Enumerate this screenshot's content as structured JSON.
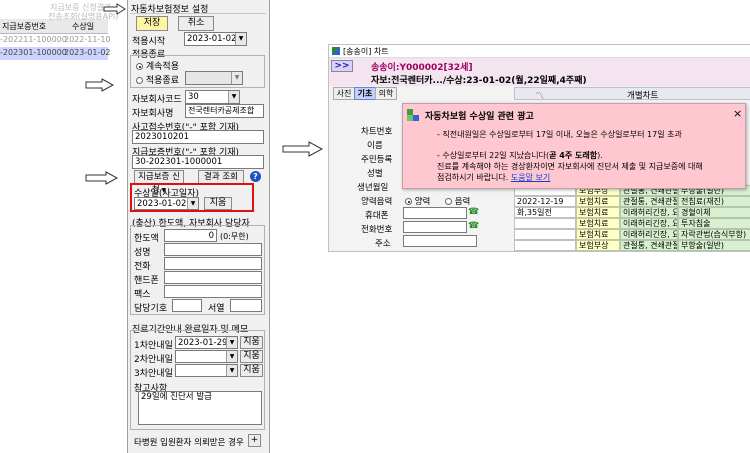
{
  "left_strip": {
    "overlay_text_1": "지급보증 신청결과",
    "overlay_text_2": "전송조회(실명용API)",
    "col_1": "지급보증번호",
    "col_2": "수상일",
    "rows": [
      {
        "no": "-202211-100000",
        "date": "2022-11-10"
      },
      {
        "no": "-202301-100000",
        "date": "2023-01-02"
      }
    ]
  },
  "panel": {
    "title": "자동차보험정보 설정",
    "save_label": "저장",
    "cancel_label": "취소",
    "apply_start_label": "적용시작",
    "apply_start_value": "2023-01-02",
    "apply_end_label": "적용종료",
    "continue_label": "계속적용",
    "end_label": "적용종료",
    "insurer_code_label": "자보회사코드",
    "insurer_code_value": "30",
    "insurer_name_label": "자보회사명",
    "insurer_name_value": "전국렌터카공제조합",
    "accident_no_label": "사고접수번호(\"-\" 포함 기재)",
    "accident_no_value": "2023010201",
    "guarantee_no_label": "지급보증번호(\"-\" 포함 기재)",
    "guarantee_no_value": "30-202301-1000001",
    "guarantee_request_label": "지급보증 신청",
    "result_query_label": "결과 조회",
    "help_icon_text": "?",
    "injury_date_label": "수상일(사고일자)",
    "injury_date_value": "2023-01-02",
    "injury_date_button": "지움",
    "limit_section_label": "(충산) 한도액, 자보회사 담당자",
    "limit_label": "한도액",
    "limit_value": "0",
    "limit_hint": "(0:무한)",
    "name_label": "성명",
    "phone_label": "전화",
    "mobile_label": "핸드폰",
    "fax_label": "팩스",
    "manager_code_label": "담당기호",
    "seoul_label": "서열",
    "memo_section_label": "진료기간안내 완료일자 및 메모",
    "notice1_label": "1차안내일",
    "notice1_value": "2023-01-29",
    "notice2_label": "2차안내일",
    "notice3_label": "3차안내일",
    "clear_label": "지움",
    "remarks_label": "참고사항",
    "remarks_value": "29일에 진단서 발급",
    "footer_label": "타병원 입원환자 의뢰받은 경우",
    "footer_button": "+"
  },
  "window": {
    "title": "[송송이] 차트",
    "patient_code_prefix": "송송이:Y000002[32세]",
    "expand_button": ">>",
    "info_line": "자보:전국렌터카.../수상:23-01-02(월,22일째,4주째)",
    "tabs": [
      "사진",
      "기초",
      "의학"
    ],
    "column_chart": "개별차트",
    "field_labels": [
      "차트번호",
      "이름",
      "주민등록",
      "성별",
      "생년월일",
      "양력음력",
      "휴대폰",
      "전화번호",
      "주소"
    ],
    "lunar_solar": {
      "solar": "양력",
      "lunar": "음력"
    },
    "rows": [
      {
        "date": "",
        "type": "보험부상",
        "desc": "관절통, 견쇄관절",
        "item": "부항술(일반)"
      },
      {
        "date": "2022-12-19",
        "type": "보험치료",
        "desc": "관절통, 견쇄관절",
        "item": "전침료(재진)"
      },
      {
        "date": "화,35일전",
        "type": "보험치료",
        "desc": "이래허리긴장, 요추",
        "item": "경혈이체"
      },
      {
        "date": "",
        "type": "보험치료",
        "desc": "이래허리긴장, 요추",
        "item": "투자침술"
      },
      {
        "date": "",
        "type": "보험치료",
        "desc": "이래허리긴장, 요추",
        "item": "자락관법(습식부항)"
      },
      {
        "date": "",
        "type": "보험부상",
        "desc": "관절통, 견쇄관절",
        "item": "부항술(일반)"
      }
    ]
  },
  "popup": {
    "title": "자동차보험 수상일 관련 광고",
    "close": "×",
    "line1": "- 직전내원일은 수상일로부터 17일 이내, 오늘은 수상일로부터 17일 초과",
    "line2_a": "- 수상일로부터 22일 지났습니다(",
    "line2_bold": "곧 4주 도래함",
    "line2_b": ").",
    "line3": "진료를 계속해야 하는 경상환자이면 자보회사에 진단서 제출 및 지급보증에 대해",
    "line4_a": "점검하시기 바랍니다. ",
    "line4_link": "도움말 보기"
  },
  "colors": {
    "popup_bg": "#ffc8d0",
    "highlight_border": "#e01010",
    "title_accent": "#a00060"
  }
}
